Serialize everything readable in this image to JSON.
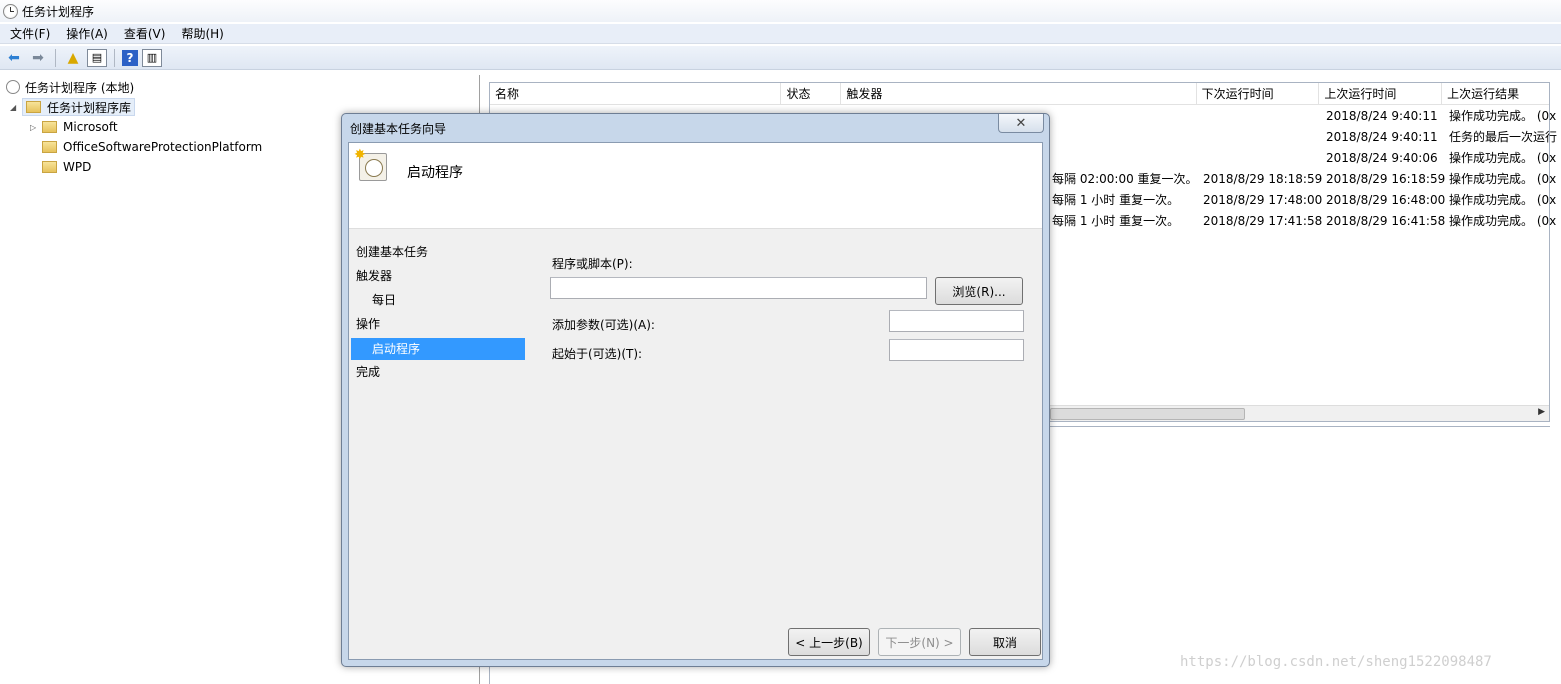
{
  "window": {
    "title": "任务计划程序"
  },
  "menu": [
    "文件(F)",
    "操作(A)",
    "查看(V)",
    "帮助(H)"
  ],
  "tree": {
    "root": "任务计划程序 (本地)",
    "library": "任务计划程序库",
    "folders": [
      "Microsoft",
      "OfficeSoftwareProtectionPlatform",
      "WPD"
    ]
  },
  "table": {
    "columns": [
      "名称",
      "状态",
      "触发器",
      "下次运行时间",
      "上次运行时间",
      "上次运行结果"
    ],
    "rows": [
      {
        "trigger_tail": "",
        "next": "",
        "last": "2018/8/24 9:40:11",
        "result": "操作成功完成。 (0x"
      },
      {
        "trigger_tail": "",
        "next": "",
        "last": "2018/8/24 9:40:11",
        "result": "任务的最后一次运行"
      },
      {
        "trigger_tail": "",
        "next": "",
        "last": "2018/8/24 9:40:06",
        "result": "操作成功完成。 (0x"
      },
      {
        "trigger_tail": "每隔 02:00:00 重复一次。",
        "next": "2018/8/29 18:18:59",
        "last": "2018/8/29 16:18:59",
        "result": "操作成功完成。 (0x"
      },
      {
        "trigger_tail": "每隔 1 小时 重复一次。",
        "next": "2018/8/29 17:48:00",
        "last": "2018/8/29 16:48:00",
        "result": "操作成功完成。 (0x"
      },
      {
        "trigger_tail": "每隔 1 小时 重复一次。",
        "next": "2018/8/29 17:41:58",
        "last": "2018/8/29 16:41:58",
        "result": "操作成功完成。 (0x"
      }
    ]
  },
  "dialog": {
    "title": "创建基本任务向导",
    "close": "✕",
    "header_title": "启动程序",
    "steps": [
      {
        "label": "创建基本任务",
        "sub": false,
        "active": false
      },
      {
        "label": "触发器",
        "sub": false,
        "active": false
      },
      {
        "label": "每日",
        "sub": true,
        "active": false
      },
      {
        "label": "操作",
        "sub": false,
        "active": false
      },
      {
        "label": "启动程序",
        "sub": true,
        "active": true
      },
      {
        "label": "完成",
        "sub": false,
        "active": false
      }
    ],
    "program_label": "程序或脚本(P):",
    "program_value": "",
    "browse": "浏览(R)...",
    "args_label": "添加参数(可选)(A):",
    "args_value": "",
    "start_label": "起始于(可选)(T):",
    "start_value": "",
    "back": "< 上一步(B)",
    "next": "下一步(N) >",
    "cancel": "取消"
  },
  "watermark": "https://blog.csdn.net/sheng1522098487"
}
